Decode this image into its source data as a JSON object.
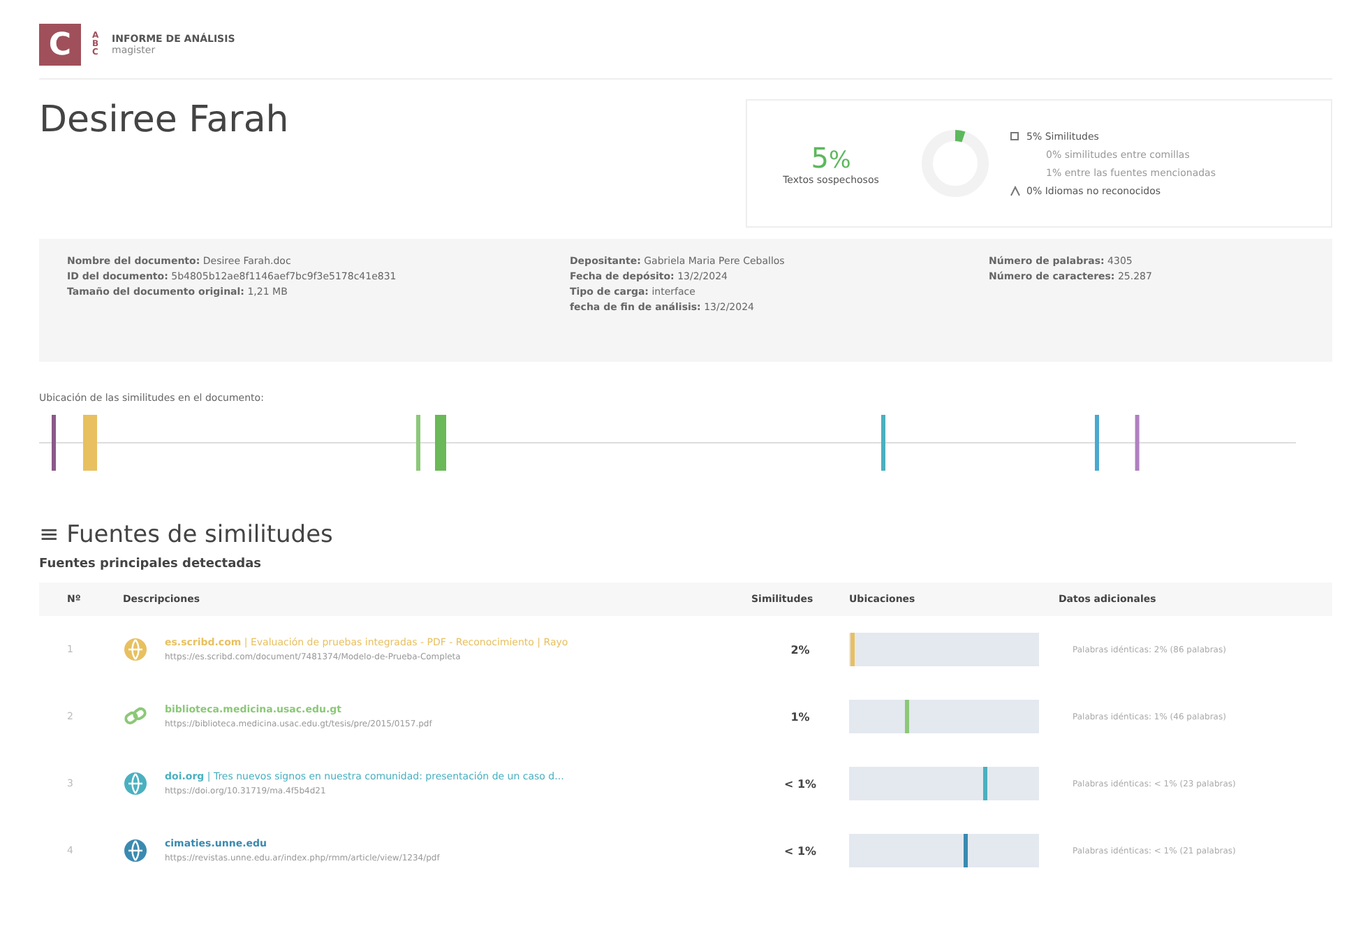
{
  "header": {
    "logo_letter": "C",
    "logo_side": "ABC",
    "title": "INFORME DE ANÁLISIS",
    "subtitle": "magister"
  },
  "document_title": "Desiree Farah",
  "summary": {
    "percent": "5",
    "unit": "%",
    "label": "Textos sospechosos",
    "items": [
      {
        "kind": "similarity",
        "text": "5%  Similitudes",
        "sub": false
      },
      {
        "kind": "detail",
        "text": "0%  similitudes entre comillas",
        "sub": true
      },
      {
        "kind": "detail",
        "text": "1%  entre las fuentes mencionadas",
        "sub": true
      },
      {
        "kind": "language",
        "text": "0%  Idiomas no reconocidos",
        "sub": false
      }
    ]
  },
  "meta": [
    [
      {
        "label": "Nombre del documento:",
        "value": "Desiree Farah.doc"
      },
      {
        "label": "ID del documento:",
        "value": "5b4805b12ae8f1146aef7bc9f3e5178c41e831"
      },
      {
        "label": "Tamaño del documento original:",
        "value": "1,21 MB"
      }
    ],
    [
      {
        "label": "Depositante:",
        "value": "Gabriela Maria Pere Ceballos"
      },
      {
        "label": "Fecha de depósito:",
        "value": "13/2/2024"
      },
      {
        "label": "Tipo de carga:",
        "value": "interface"
      },
      {
        "label": "fecha de fin de análisis:",
        "value": "13/2/2024"
      }
    ],
    [
      {
        "label": "Número de palabras:",
        "value": "4305"
      },
      {
        "label": "Número de caracteres:",
        "value": "25.287"
      }
    ]
  ],
  "location_label": "Ubicación de las similitudes en el documento:",
  "sources_title": "Fuentes de similitudes",
  "sources_icon": "≡",
  "sources_subtitle": "Fuentes principales detectadas",
  "table": {
    "columns": [
      "Nº",
      "Descripciones",
      "Similitudes",
      "Ubicaciones",
      "Datos adicionales"
    ],
    "rows": [
      {
        "number": "1",
        "kind": "web",
        "color": "#e8c060",
        "title": "es.scribd.com",
        "rest": " | Evaluación de pruebas integradas - PDF - Reconocimiento | Rayo",
        "url": "https://es.scribd.com/document/7481374/Modelo-de-Prueba-Completa",
        "similarity": "2%",
        "extra": "Palabras idénticas: 2% (86 palabras)"
      },
      {
        "number": "2",
        "kind": "link",
        "color": "#8cc878",
        "title": "biblioteca.medicina.usac.edu.gt",
        "rest": "",
        "url": "https://biblioteca.medicina.usac.edu.gt/tesis/pre/2015/0157.pdf",
        "similarity": "1%",
        "extra": "Palabras idénticas: 1% (46 palabras)"
      },
      {
        "number": "3",
        "kind": "web",
        "color": "#4ab0c0",
        "title": "doi.org",
        "rest": " | Tres nuevos signos en nuestra comunidad: presentación de un caso d...",
        "url": "https://doi.org/10.31719/ma.4f5b4d21",
        "similarity": "< 1%",
        "extra": "Palabras idénticas: < 1% (23 palabras)"
      },
      {
        "number": "4",
        "kind": "web",
        "color": "#3a8ab0",
        "title": "cimaties.unne.edu",
        "rest": "",
        "url": "https://revistas.unne.edu.ar/index.php/rmm/article/view/1234/pdf",
        "similarity": "< 1%",
        "extra": "Palabras idénticas: < 1% (21 palabras)"
      }
    ]
  }
}
